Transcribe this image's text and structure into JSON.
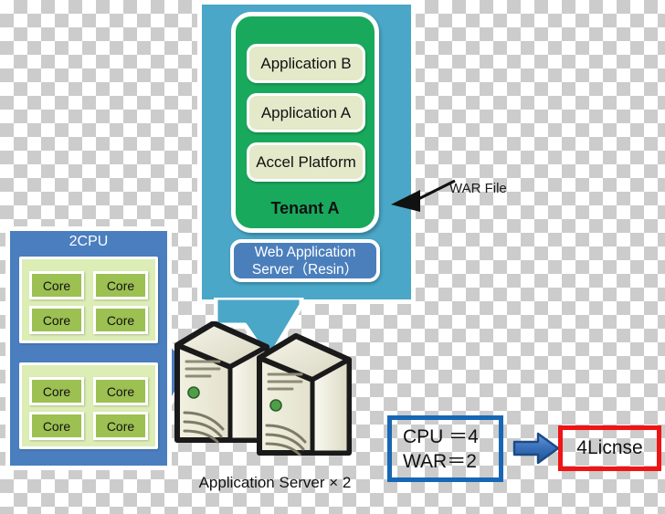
{
  "diagram": {
    "title": "Application Server Licensing Diagram",
    "colors": {
      "teal_callout": "#4aa7c7",
      "tenant_green": "#18a95c",
      "app_box_cream": "#e3e9c9",
      "was_blue": "#4b7fbc",
      "cpu_blue": "#4a7ebf",
      "core_green": "#9cc052",
      "core_panel": "#dcedb5",
      "formula_border": "#1767b5",
      "license_border": "#f01414",
      "arrow_blue": "#2f66ad"
    }
  },
  "callout": {
    "tenant": {
      "label": "Tenant A",
      "apps": [
        {
          "label": "Application B"
        },
        {
          "label": "Application A"
        },
        {
          "label": "Accel Platform"
        }
      ]
    },
    "web_application_server": {
      "line1": "Web Application",
      "line2": "Server（Resin）"
    }
  },
  "war_annotation": {
    "label": "WAR File",
    "arrow_icon": "left-arrow-icon"
  },
  "cpu_panel": {
    "title": "2CPU",
    "groups": [
      {
        "cores": [
          "Core",
          "Core",
          "Core",
          "Core"
        ]
      },
      {
        "cores": [
          "Core",
          "Core",
          "Core",
          "Core"
        ]
      }
    ]
  },
  "servers": {
    "label": "Application Server × 2",
    "icon": "server-tower-icon",
    "count": 2
  },
  "formula": {
    "line1": "CPU ＝4",
    "line2": "WAR＝2",
    "arrow_icon": "right-arrow-icon",
    "result": "4Licnse"
  }
}
